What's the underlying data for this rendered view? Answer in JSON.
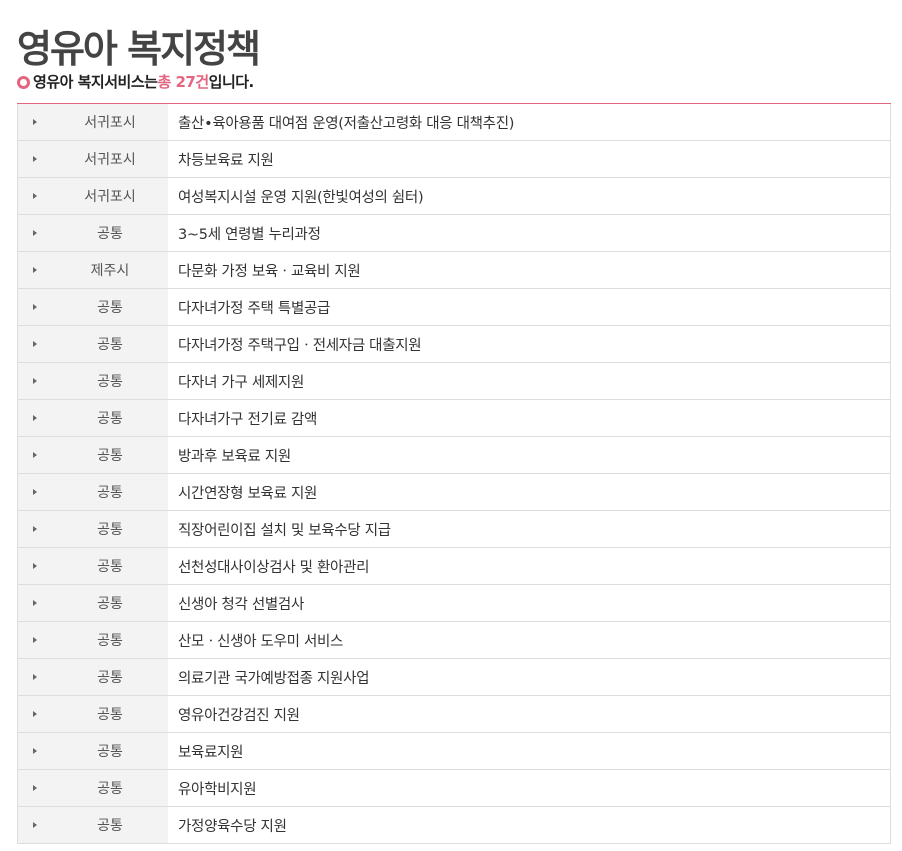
{
  "page": {
    "title": "영유아 복지정책"
  },
  "summary": {
    "prefix": "영유아 복지서비스는 ",
    "count_text": "총 27건",
    "suffix": "입니다."
  },
  "services": [
    {
      "region": "서귀포시",
      "title": "출산•육아용품 대여점 운영(저출산고령화 대응 대책추진)"
    },
    {
      "region": "서귀포시",
      "title": "차등보육료 지원"
    },
    {
      "region": "서귀포시",
      "title": "여성복지시설 운영 지원(한빛여성의 쉼터)"
    },
    {
      "region": "공통",
      "title": " 3~5세 연령별 누리과정"
    },
    {
      "region": "제주시",
      "title": "다문화 가정 보육ㆍ교육비 지원"
    },
    {
      "region": "공통",
      "title": "다자녀가정 주택 특별공급"
    },
    {
      "region": "공통",
      "title": "다자녀가정 주택구입ㆍ전세자금 대출지원"
    },
    {
      "region": "공통",
      "title": "다자녀 가구 세제지원"
    },
    {
      "region": "공통",
      "title": "다자녀가구 전기료 감액"
    },
    {
      "region": "공통",
      "title": "방과후 보육료 지원"
    },
    {
      "region": "공통",
      "title": "시간연장형 보육료 지원"
    },
    {
      "region": "공통",
      "title": "직장어린이집 설치 및 보육수당 지급"
    },
    {
      "region": "공통",
      "title": "선천성대사이상검사 및 환아관리"
    },
    {
      "region": "공통",
      "title": "신생아 청각 선별검사"
    },
    {
      "region": "공통",
      "title": "산모ㆍ신생아 도우미 서비스"
    },
    {
      "region": "공통",
      "title": "의료기관 국가예방접종 지원사업"
    },
    {
      "region": "공통",
      "title": "영유아건강검진 지원"
    },
    {
      "region": "공통",
      "title": "보육료지원"
    },
    {
      "region": "공통",
      "title": "유아학비지원"
    },
    {
      "region": "공통",
      "title": "가정양육수당 지원"
    }
  ]
}
